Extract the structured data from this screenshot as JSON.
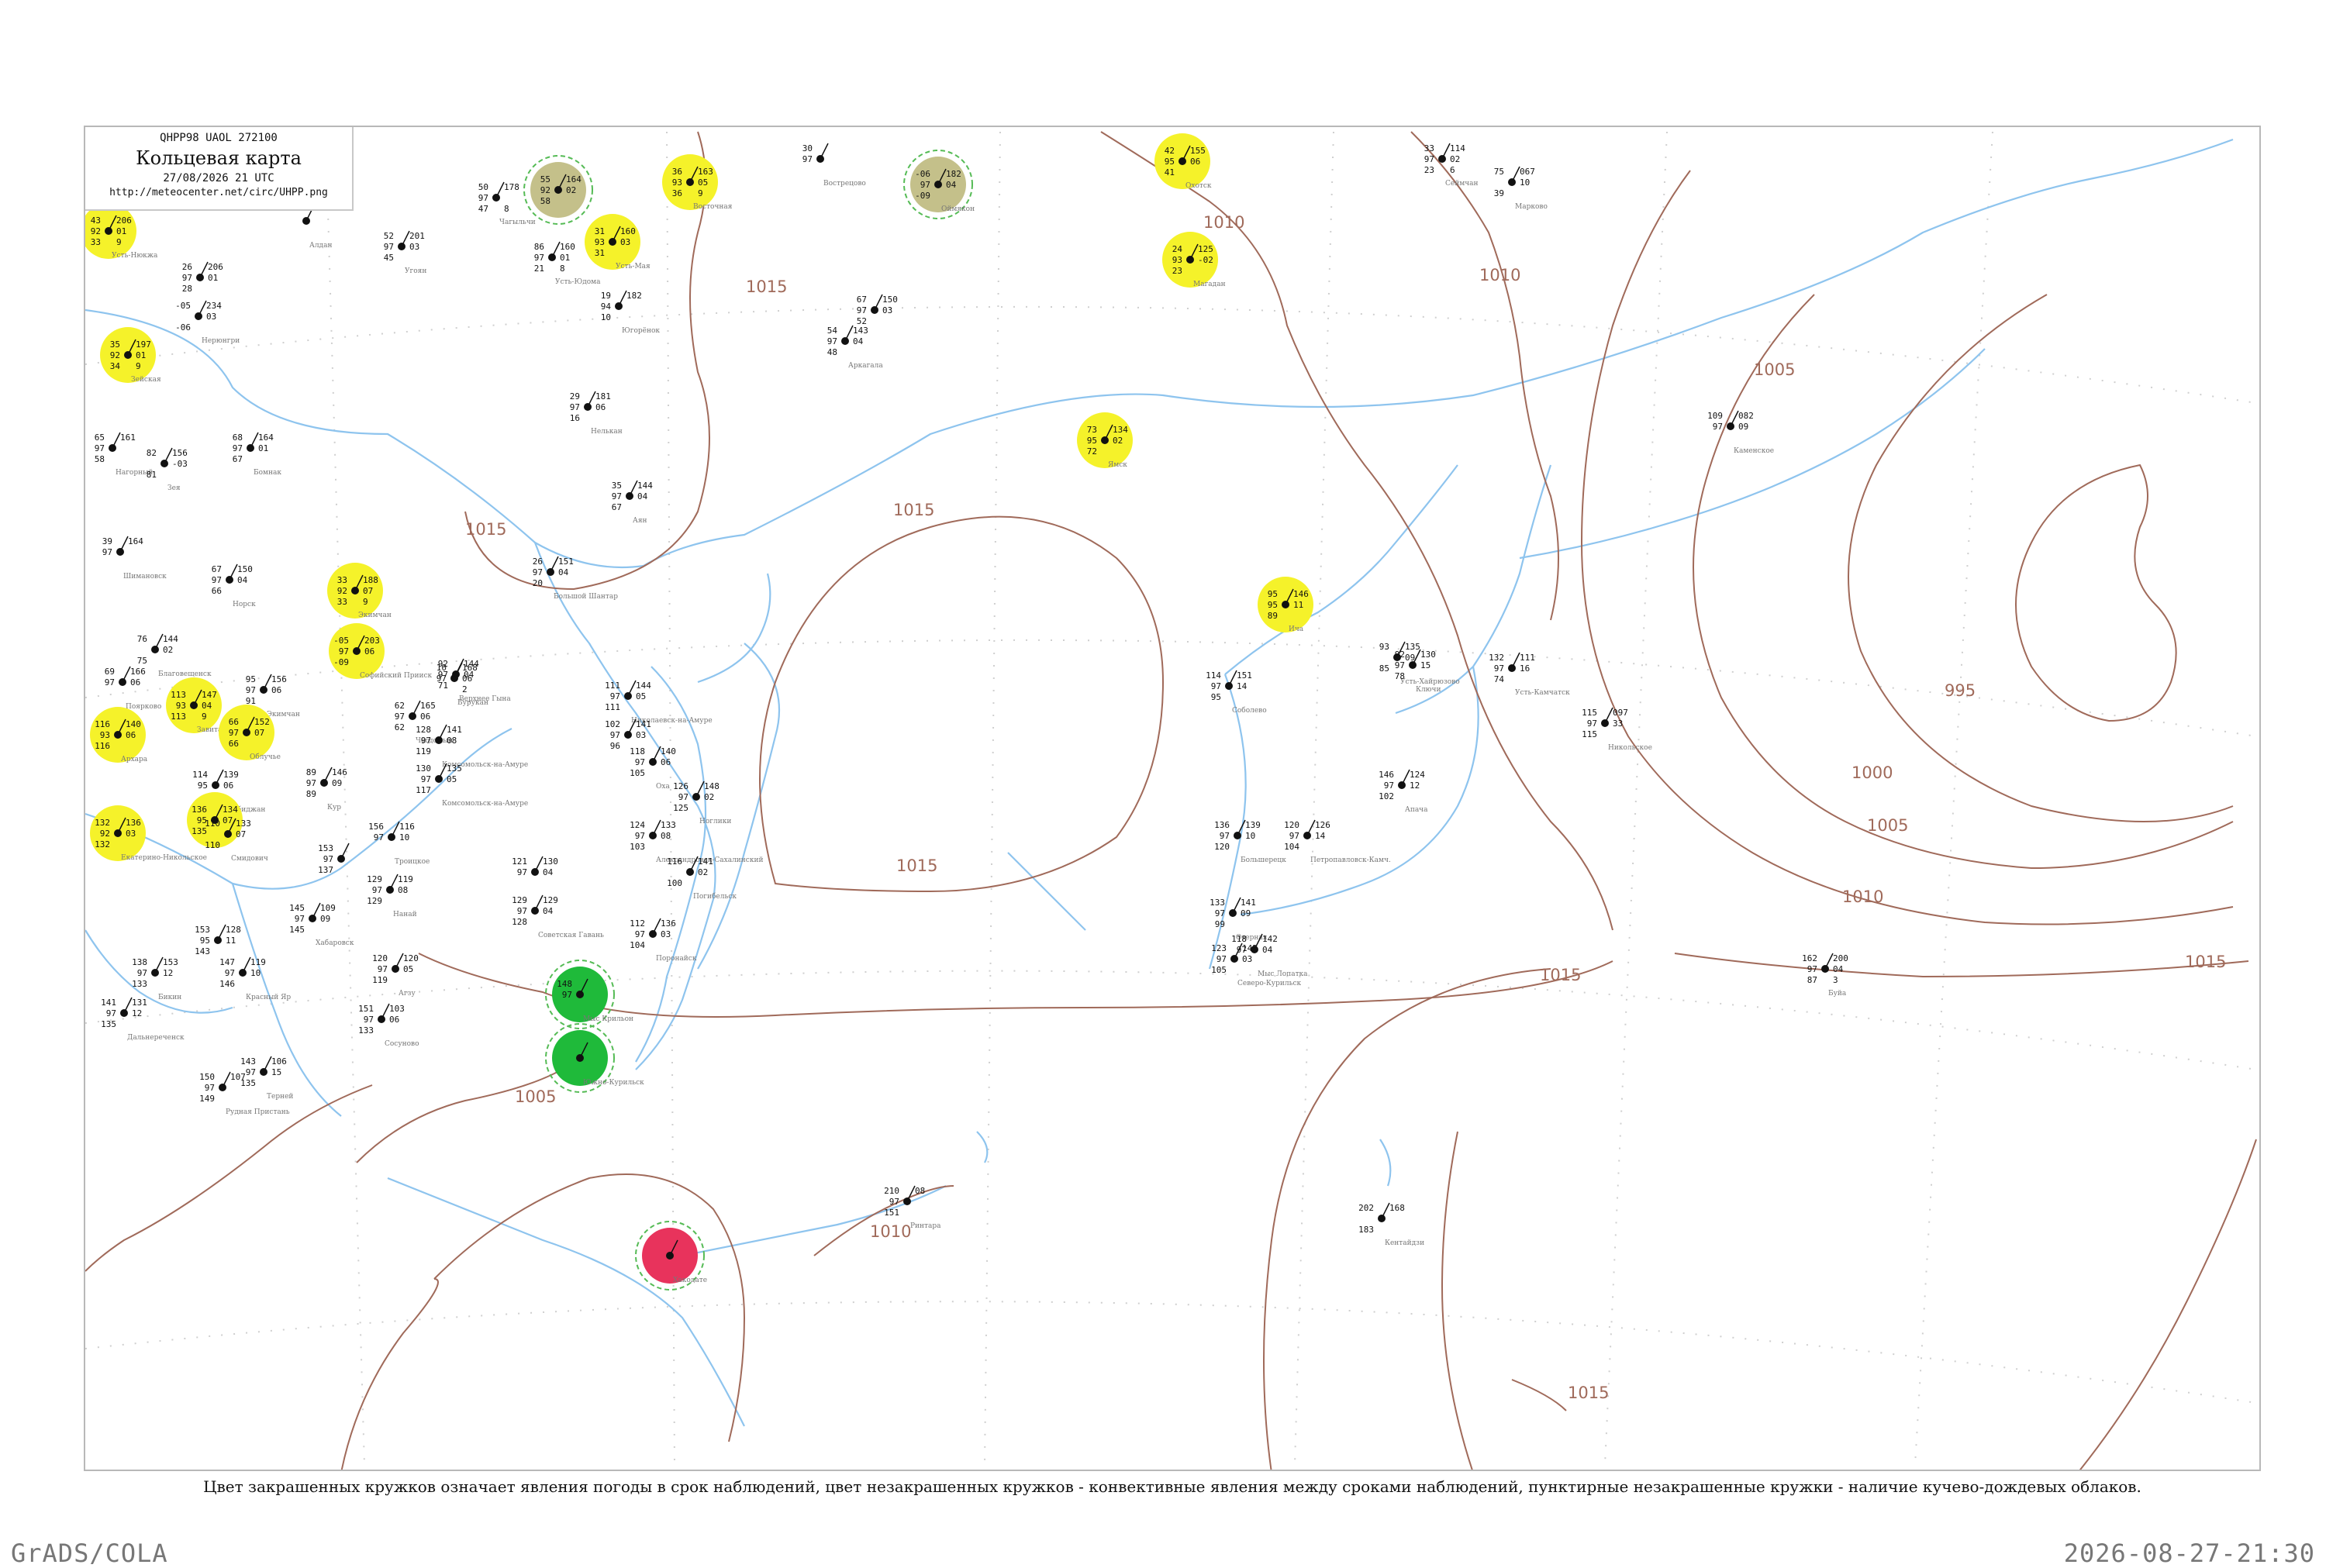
{
  "header": {
    "code": "QHPP98  UAOL  272100",
    "title": "Кольцевая карта",
    "date": "27/08/2026 21 UTC",
    "url": "http://meteocenter.net/circ/UHPP.png"
  },
  "footnote": "Цвет закрашенных кружков означает явления погоды в срок наблюдений, цвет незакрашенных кружков - конвективные явления между сроками наблюдений, пунктирные незакрашенные кружки - наличие кучево-дождевых облаков.",
  "credit": "GrADS/COLA",
  "timestamp": "2026-08-27-21:30",
  "colors": {
    "isobar": "#a06a5a",
    "water": "#8ec4ee",
    "station_yellow": "#f5f22a",
    "station_olive": "#c4c08a",
    "station_green": "#1fba3a",
    "station_red": "#e8335c",
    "convective_ring": "#55bb55"
  },
  "isobar_labels": [
    "1015",
    "1015",
    "1015",
    "1015",
    "1010",
    "1010",
    "1005",
    "995",
    "1000",
    "1005",
    "1010",
    "1015",
    "1015",
    "1010",
    "1005",
    "1015"
  ],
  "stations": [
    {
      "top": "43",
      "left": "92",
      "bottom": "33",
      "right": "206",
      "right2": "01",
      "right3": "9",
      "name": "Усть-Нюкжа",
      "fill": "yellow"
    },
    {
      "top": "",
      "left": "",
      "bottom": "",
      "right": "",
      "right2": "",
      "right3": "",
      "name": "Алдан",
      "fill": ""
    },
    {
      "top": "26",
      "left": "97",
      "bottom": "28",
      "right": "206",
      "right2": "01",
      "right3": "",
      "name": "",
      "fill": ""
    },
    {
      "top": "-05",
      "left": "",
      "bottom": "-06",
      "right": "234",
      "right2": "03",
      "right3": "",
      "name": "Нерюнгри",
      "fill": ""
    },
    {
      "top": "35",
      "left": "92",
      "bottom": "34",
      "right": "197",
      "right2": "01",
      "right3": "9",
      "name": "Зейская",
      "fill": "yellow"
    },
    {
      "top": "65",
      "left": "97",
      "bottom": "58",
      "right": "161",
      "right2": "",
      "right3": "",
      "name": "Нагорный",
      "fill": ""
    },
    {
      "top": "82",
      "left": "",
      "bottom": "81",
      "right": "156",
      "right2": "-03",
      "right3": "",
      "name": "Зея",
      "fill": ""
    },
    {
      "top": "68",
      "left": "97",
      "bottom": "67",
      "right": "164",
      "right2": "01",
      "right3": "",
      "name": "Бомнак",
      "fill": ""
    },
    {
      "top": "50",
      "left": "97",
      "bottom": "47",
      "right": "178",
      "right2": "",
      "right3": "8",
      "name": "Чагыльчи",
      "fill": ""
    },
    {
      "top": "52",
      "left": "97",
      "bottom": "45",
      "right": "201",
      "right2": "03",
      "right3": "",
      "name": "Угоян",
      "fill": ""
    },
    {
      "top": "55",
      "left": "92",
      "bottom": "58",
      "right": "164",
      "right2": "02",
      "right3": "",
      "name": "",
      "fill": "olive"
    },
    {
      "top": "86",
      "left": "97",
      "bottom": "21",
      "right": "160",
      "right2": "01",
      "right3": "8",
      "name": "Усть-Юдома",
      "fill": ""
    },
    {
      "top": "31",
      "left": "93",
      "bottom": "31",
      "right": "160",
      "right2": "03",
      "right3": "",
      "name": "Усть-Мая",
      "fill": "yellow"
    },
    {
      "top": "19",
      "left": "94",
      "bottom": "10",
      "right": "182",
      "right2": "",
      "right3": "",
      "name": "Югорёнок",
      "fill": ""
    },
    {
      "top": "36",
      "left": "93",
      "bottom": "36",
      "right": "163",
      "right2": "05",
      "right3": "9",
      "name": "Восточная",
      "fill": "yellow"
    },
    {
      "top": "30",
      "left": "97",
      "bottom": "",
      "right": "",
      "right2": "",
      "right3": "",
      "name": "Вострецово",
      "fill": ""
    },
    {
      "top": "-06",
      "left": "97",
      "bottom": "-09",
      "right": "182",
      "right2": "04",
      "right3": "",
      "name": "Оймякон",
      "fill": "olive"
    },
    {
      "top": "67",
      "left": "97",
      "bottom": "52",
      "right": "150",
      "right2": "03",
      "right3": "",
      "name": "",
      "fill": ""
    },
    {
      "top": "54",
      "left": "97",
      "bottom": "48",
      "right": "143",
      "right2": "04",
      "right3": "",
      "name": "Аркагала",
      "fill": ""
    },
    {
      "top": "29",
      "left": "97",
      "bottom": "16",
      "right": "181",
      "right2": "06",
      "right3": "",
      "name": "Нелькан",
      "fill": ""
    },
    {
      "top": "35",
      "left": "97",
      "bottom": "67",
      "right": "144",
      "right2": "04",
      "right3": "",
      "name": "Аян",
      "fill": ""
    },
    {
      "top": "42",
      "left": "95",
      "bottom": "41",
      "right": "155",
      "right2": "06",
      "right3": "",
      "name": "Охотск",
      "fill": "yellow"
    },
    {
      "top": "24",
      "left": "93",
      "bottom": "23",
      "right": "125",
      "right2": "-02",
      "right3": "",
      "name": "Магадан",
      "fill": "yellow"
    },
    {
      "top": "33",
      "left": "97",
      "bottom": "23",
      "right": "114",
      "right2": "02",
      "right3": "6",
      "name": "Сеймчан",
      "fill": ""
    },
    {
      "top": "75",
      "left": "",
      "bottom": "39",
      "right": "067",
      "right2": "10",
      "right3": "",
      "name": "Марково",
      "fill": ""
    },
    {
      "top": "73",
      "left": "95",
      "bottom": "72",
      "right": "134",
      "right2": "02",
      "right3": "",
      "name": "Ямск",
      "fill": "yellow"
    },
    {
      "top": "109",
      "left": "97",
      "bottom": "",
      "right": "082",
      "right2": "09",
      "right3": "",
      "name": "Каменское",
      "fill": ""
    },
    {
      "top": "39",
      "left": "97",
      "bottom": "",
      "right": "164",
      "right2": "",
      "right3": "",
      "name": "Шимановск",
      "fill": ""
    },
    {
      "top": "67",
      "left": "97",
      "bottom": "66",
      "right": "150",
      "right2": "04",
      "right3": "",
      "name": "Норск",
      "fill": ""
    },
    {
      "top": "33",
      "left": "92",
      "bottom": "33",
      "right": "188",
      "right2": "07",
      "right3": "9",
      "name": "Экимчан",
      "fill": "yellow"
    },
    {
      "top": "-05",
      "left": "97",
      "bottom": "-09",
      "right": "203",
      "right2": "06",
      "right3": "",
      "name": "Софийский Прииск",
      "fill": "yellow"
    },
    {
      "top": "26",
      "left": "97",
      "bottom": "20",
      "right": "151",
      "right2": "04",
      "right3": "",
      "name": "Большой Шантар",
      "fill": ""
    },
    {
      "top": "76",
      "left": "",
      "bottom": "75",
      "right": "144",
      "right2": "02",
      "right3": "",
      "name": "Благовещенск",
      "fill": ""
    },
    {
      "top": "69",
      "left": "97",
      "bottom": "",
      "right": "166",
      "right2": "06",
      "right3": "",
      "name": "Поярково",
      "fill": ""
    },
    {
      "top": "113",
      "left": "93",
      "bottom": "113",
      "right": "147",
      "right2": "04",
      "right3": "9",
      "name": "Завитая",
      "fill": "yellow"
    },
    {
      "top": "95",
      "left": "97",
      "bottom": "91",
      "right": "156",
      "right2": "06",
      "right3": "",
      "name": "Экимчан",
      "fill": ""
    },
    {
      "top": "116",
      "left": "93",
      "bottom": "116",
      "right": "140",
      "right2": "06",
      "right3": "",
      "name": "Архара",
      "fill": "yellow"
    },
    {
      "top": "66",
      "left": "97",
      "bottom": "66",
      "right": "152",
      "right2": "07",
      "right3": "",
      "name": "Облучье",
      "fill": "yellow"
    },
    {
      "top": "62",
      "left": "97",
      "bottom": "62",
      "right": "165",
      "right2": "06",
      "right3": "",
      "name": "Чегдомын",
      "fill": ""
    },
    {
      "top": "92",
      "left": "97",
      "bottom": "71",
      "right": "144",
      "right2": "04",
      "right3": "",
      "name": "Верхнее Гына",
      "fill": ""
    },
    {
      "top": "10",
      "left": "97",
      "bottom": "",
      "right": "168",
      "right2": "06",
      "right3": "2",
      "name": "Бурукан",
      "fill": ""
    },
    {
      "top": "128",
      "left": "97",
      "bottom": "119",
      "right": "141",
      "right2": "08",
      "right3": "",
      "name": "Комсомольск-на-Амуре",
      "fill": ""
    },
    {
      "top": "130",
      "left": "97",
      "bottom": "117",
      "right": "135",
      "right2": "05",
      "right3": "",
      "name": "Комсомольск-на-Амуре",
      "fill": ""
    },
    {
      "top": "111",
      "left": "97",
      "bottom": "111",
      "right": "144",
      "right2": "05",
      "right3": "",
      "name": "Николаевск-на-Амуре",
      "fill": ""
    },
    {
      "top": "102",
      "left": "97",
      "bottom": "96",
      "right": "141",
      "right2": "03",
      "right3": "",
      "name": "",
      "fill": ""
    },
    {
      "top": "118",
      "left": "97",
      "bottom": "105",
      "right": "140",
      "right2": "06",
      "right3": "",
      "name": "Оха",
      "fill": ""
    },
    {
      "top": "126",
      "left": "97",
      "bottom": "125",
      "right": "148",
      "right2": "02",
      "right3": "",
      "name": "Ноглики",
      "fill": ""
    },
    {
      "top": "89",
      "left": "97",
      "bottom": "89",
      "right": "146",
      "right2": "09",
      "right3": "",
      "name": "Кур",
      "fill": ""
    },
    {
      "top": "114",
      "left": "95",
      "bottom": "",
      "right": "139",
      "right2": "06",
      "right3": "",
      "name": "Биробиджан",
      "fill": ""
    },
    {
      "top": "132",
      "left": "92",
      "bottom": "132",
      "right": "136",
      "right2": "03",
      "right3": "",
      "name": "Екатерино-Никольское",
      "fill": "yellow"
    },
    {
      "top": "136",
      "left": "95",
      "bottom": "135",
      "right": "134",
      "right2": "07",
      "right3": "",
      "name": "",
      "fill": "yellow"
    },
    {
      "top": "110",
      "left": "",
      "bottom": "110",
      "right": "133",
      "right2": "07",
      "right3": "",
      "name": "Смидович",
      "fill": ""
    },
    {
      "top": "153",
      "left": "97",
      "bottom": "137",
      "right": "",
      "right2": "",
      "right3": "",
      "name": "",
      "fill": ""
    },
    {
      "top": "156",
      "left": "97",
      "bottom": "",
      "right": "116",
      "right2": "10",
      "right3": "",
      "name": "Троицкое",
      "fill": ""
    },
    {
      "top": "129",
      "left": "97",
      "bottom": "129",
      "right": "119",
      "right2": "08",
      "right3": "",
      "name": "Нанай",
      "fill": ""
    },
    {
      "top": "124",
      "left": "97",
      "bottom": "103",
      "right": "133",
      "right2": "08",
      "right3": "",
      "name": "Александровск-Сахалинский",
      "fill": ""
    },
    {
      "top": "116",
      "left": "",
      "bottom": "100",
      "right": "141",
      "right2": "02",
      "right3": "",
      "name": "Погибельск",
      "fill": ""
    },
    {
      "top": "121",
      "left": "97",
      "bottom": "",
      "right": "130",
      "right2": "04",
      "right3": "",
      "name": "",
      "fill": ""
    },
    {
      "top": "129",
      "left": "97",
      "bottom": "128",
      "right": "129",
      "right2": "04",
      "right3": "",
      "name": "Советская Гавань",
      "fill": ""
    },
    {
      "top": "145",
      "left": "97",
      "bottom": "145",
      "right": "109",
      "right2": "09",
      "right3": "",
      "name": "Хабаровск",
      "fill": ""
    },
    {
      "top": "112",
      "left": "97",
      "bottom": "104",
      "right": "136",
      "right2": "03",
      "right3": "",
      "name": "Поронайск",
      "fill": ""
    },
    {
      "top": "153",
      "left": "95",
      "bottom": "143",
      "right": "128",
      "right2": "11",
      "right3": "",
      "name": "",
      "fill": ""
    },
    {
      "top": "138",
      "left": "97",
      "bottom": "133",
      "right": "153",
      "right2": "12",
      "right3": "",
      "name": "Бикин",
      "fill": ""
    },
    {
      "top": "147",
      "left": "97",
      "bottom": "146",
      "right": "119",
      "right2": "10",
      "right3": "",
      "name": "Красный Яр",
      "fill": ""
    },
    {
      "top": "120",
      "left": "97",
      "bottom": "119",
      "right": "120",
      "right2": "05",
      "right3": "",
      "name": "Агзу",
      "fill": ""
    },
    {
      "top": "141",
      "left": "97",
      "bottom": "135",
      "right": "131",
      "right2": "12",
      "right3": "",
      "name": "Дальнереченск",
      "fill": ""
    },
    {
      "top": "151",
      "left": "97",
      "bottom": "133",
      "right": "103",
      "right2": "06",
      "right3": "",
      "name": "Сосуново",
      "fill": ""
    },
    {
      "top": "148",
      "left": "97",
      "bottom": "",
      "right": "",
      "right2": "",
      "right3": "",
      "name": "Мыс Крильон",
      "fill": "green"
    },
    {
      "top": "150",
      "left": "97",
      "bottom": "149",
      "right": "107",
      "right2": "",
      "right3": "",
      "name": "Рудная Пристань",
      "fill": ""
    },
    {
      "top": "143",
      "left": "97",
      "bottom": "135",
      "right": "106",
      "right2": "15",
      "right3": "",
      "name": "Терней",
      "fill": ""
    },
    {
      "top": "",
      "left": "",
      "bottom": "",
      "right": "",
      "right2": "",
      "right3": "",
      "name": "Южно-Курильск",
      "fill": "green"
    },
    {
      "top": "",
      "left": "",
      "bottom": "",
      "right": "",
      "right2": "",
      "right3": "",
      "name": "Хакодате",
      "fill": "red"
    },
    {
      "top": "210",
      "left": "97",
      "bottom": "151",
      "right": "08",
      "right2": "",
      "right3": "",
      "name": "Ринтара",
      "fill": ""
    },
    {
      "top": "202",
      "left": "",
      "bottom": "183",
      "right": "168",
      "right2": "",
      "right3": "",
      "name": "Кентайдзи",
      "fill": ""
    },
    {
      "top": "93",
      "left": "",
      "bottom": "85",
      "right": "135",
      "right2": "09",
      "right3": "",
      "name": "Усть-Хайрюзово",
      "fill": ""
    },
    {
      "top": "95",
      "left": "95",
      "bottom": "89",
      "right": "146",
      "right2": "11",
      "right3": "",
      "name": "Ича",
      "fill": "yellow"
    },
    {
      "top": "114",
      "left": "97",
      "bottom": "95",
      "right": "151",
      "right2": "14",
      "right3": "",
      "name": "Соболево",
      "fill": ""
    },
    {
      "top": "92",
      "left": "97",
      "bottom": "78",
      "right": "130",
      "right2": "15",
      "right3": "",
      "name": "Ключи",
      "fill": ""
    },
    {
      "top": "132",
      "left": "97",
      "bottom": "74",
      "right": "111",
      "right2": "16",
      "right3": "",
      "name": "Усть-Камчатск",
      "fill": ""
    },
    {
      "top": "115",
      "left": "97",
      "bottom": "115",
      "right": "097",
      "right2": "33",
      "right3": "",
      "name": "Никольское",
      "fill": ""
    },
    {
      "top": "146",
      "left": "97",
      "bottom": "102",
      "right": "124",
      "right2": "12",
      "right3": "",
      "name": "Апача",
      "fill": ""
    },
    {
      "top": "136",
      "left": "97",
      "bottom": "120",
      "right": "139",
      "right2": "10",
      "right3": "",
      "name": "Большерецк",
      "fill": ""
    },
    {
      "top": "120",
      "left": "97",
      "bottom": "104",
      "right": "126",
      "right2": "14",
      "right3": "",
      "name": "Петропавловск-Камч.",
      "fill": ""
    },
    {
      "top": "133",
      "left": "97",
      "bottom": "99",
      "right": "141",
      "right2": "09",
      "right3": "",
      "name": "Озерная",
      "fill": ""
    },
    {
      "top": "123",
      "left": "97",
      "bottom": "105",
      "right": "142",
      "right2": "03",
      "right3": "",
      "name": "Северо-Курильск",
      "fill": ""
    },
    {
      "top": "118",
      "left": "97",
      "bottom": "",
      "right": "142",
      "right2": "04",
      "right3": "",
      "name": "Мыс Лопатка",
      "fill": ""
    },
    {
      "top": "162",
      "left": "97",
      "bottom": "87",
      "right": "200",
      "right2": "04",
      "right3": "3",
      "name": "Буйа",
      "fill": ""
    }
  ]
}
